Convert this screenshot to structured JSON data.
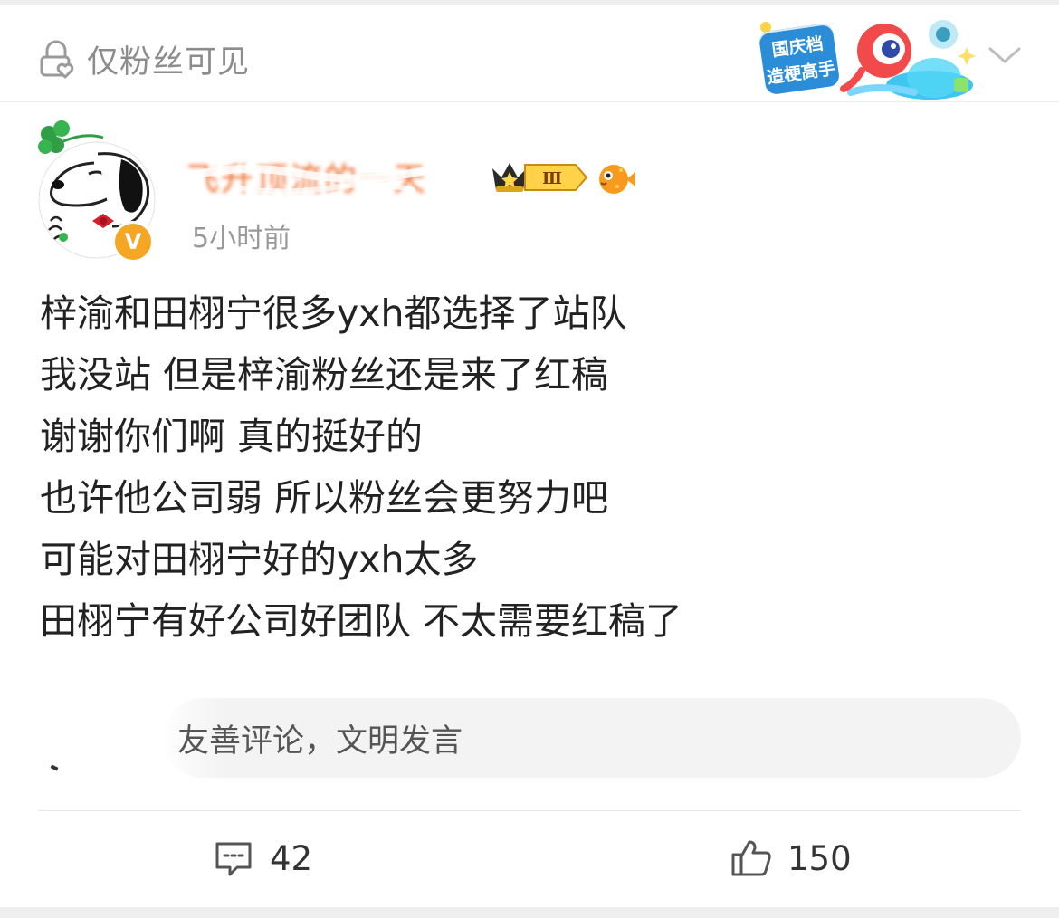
{
  "header": {
    "visibility_icon": "lock-heart-icon",
    "visibility_label": "仅粉丝可见",
    "promo_line1": "国庆档",
    "promo_line2": "造梗高手",
    "expand_icon": "chevron-down-icon"
  },
  "author": {
    "name": "飞升顶流的一天",
    "verified_badge": "V",
    "rank_badge": "Ⅲ",
    "time": "5小时前"
  },
  "post": {
    "lines": [
      "梓渝和田栩宁很多yxh都选择了站队",
      "我没站  但是梓渝粉丝还是来了红稿",
      "谢谢你们啊  真的挺好的",
      "也许他公司弱  所以粉丝会更努力吧",
      "可能对田栩宁好的yxh太多",
      "田栩宁有好公司好团队 不太需要红稿了"
    ]
  },
  "comment_input": {
    "placeholder": "友善评论，文明发言"
  },
  "actions": {
    "comment_icon": "comment-icon",
    "comment_count": "42",
    "like_icon": "thumbs-up-icon",
    "like_count": "150"
  },
  "colors": {
    "username": "#f07030",
    "muted_text": "#8c8c8c",
    "body_text": "#222222",
    "verified_badge": "#f5a623",
    "promo_blue": "#2b8dd8"
  }
}
